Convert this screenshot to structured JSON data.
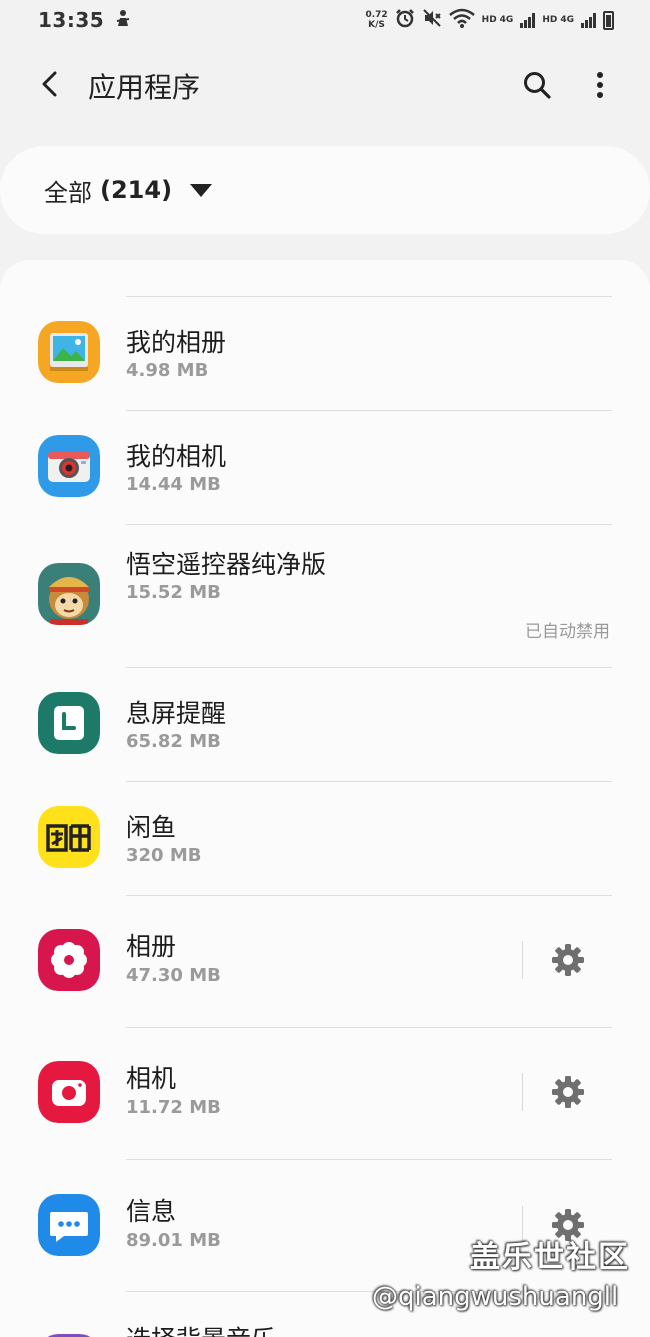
{
  "status_bar": {
    "time": "13:35",
    "net_speed_value": "0.72",
    "net_speed_unit": "K/S",
    "hd1": "HD",
    "net1": "4G",
    "hd2": "HD",
    "net2": "4G",
    "icons": [
      "figure-icon",
      "alarm-icon",
      "mute-icon",
      "wifi-icon",
      "signal-icon",
      "signal-icon",
      "battery-icon"
    ]
  },
  "app_bar": {
    "title": "应用程序",
    "icons": [
      "back-arrow-icon",
      "search-icon",
      "more-vert-icon"
    ]
  },
  "filter": {
    "label": "全部",
    "count": "(214)"
  },
  "apps": [
    {
      "name": "我的相册",
      "size": "4.98 MB",
      "icon": "photo-album-icon",
      "color": "#f5a623"
    },
    {
      "name": "我的相机",
      "size": "14.44 MB",
      "icon": "camera-app-icon",
      "color": "#2f9be8"
    },
    {
      "name": "悟空遥控器纯净版",
      "size": "15.52 MB",
      "status": "已自动禁用",
      "icon": "monkey-king-icon",
      "color": "#3a7f78"
    },
    {
      "name": "息屏提醒",
      "size": "65.82 MB",
      "icon": "clock-icon",
      "color": "#1d7a68"
    },
    {
      "name": "闲鱼",
      "size": "320 MB",
      "icon": "xianyu-logo-icon",
      "color": "#ffe11b"
    },
    {
      "name": "相册",
      "size": "47.30 MB",
      "icon": "flower-icon",
      "color": "#d7164e",
      "settings": true
    },
    {
      "name": "相机",
      "size": "11.72 MB",
      "icon": "camera-icon",
      "color": "#e5193f",
      "settings": true
    },
    {
      "name": "信息",
      "size": "89.01 MB",
      "icon": "message-icon",
      "color": "#1f8ae8",
      "settings": true
    },
    {
      "name": "选择背景音乐",
      "size": "",
      "icon": "music-icon",
      "color": "#7c4ec2"
    }
  ],
  "watermark": {
    "title": "盖乐世社区",
    "user": "@qiangwushuangll"
  }
}
